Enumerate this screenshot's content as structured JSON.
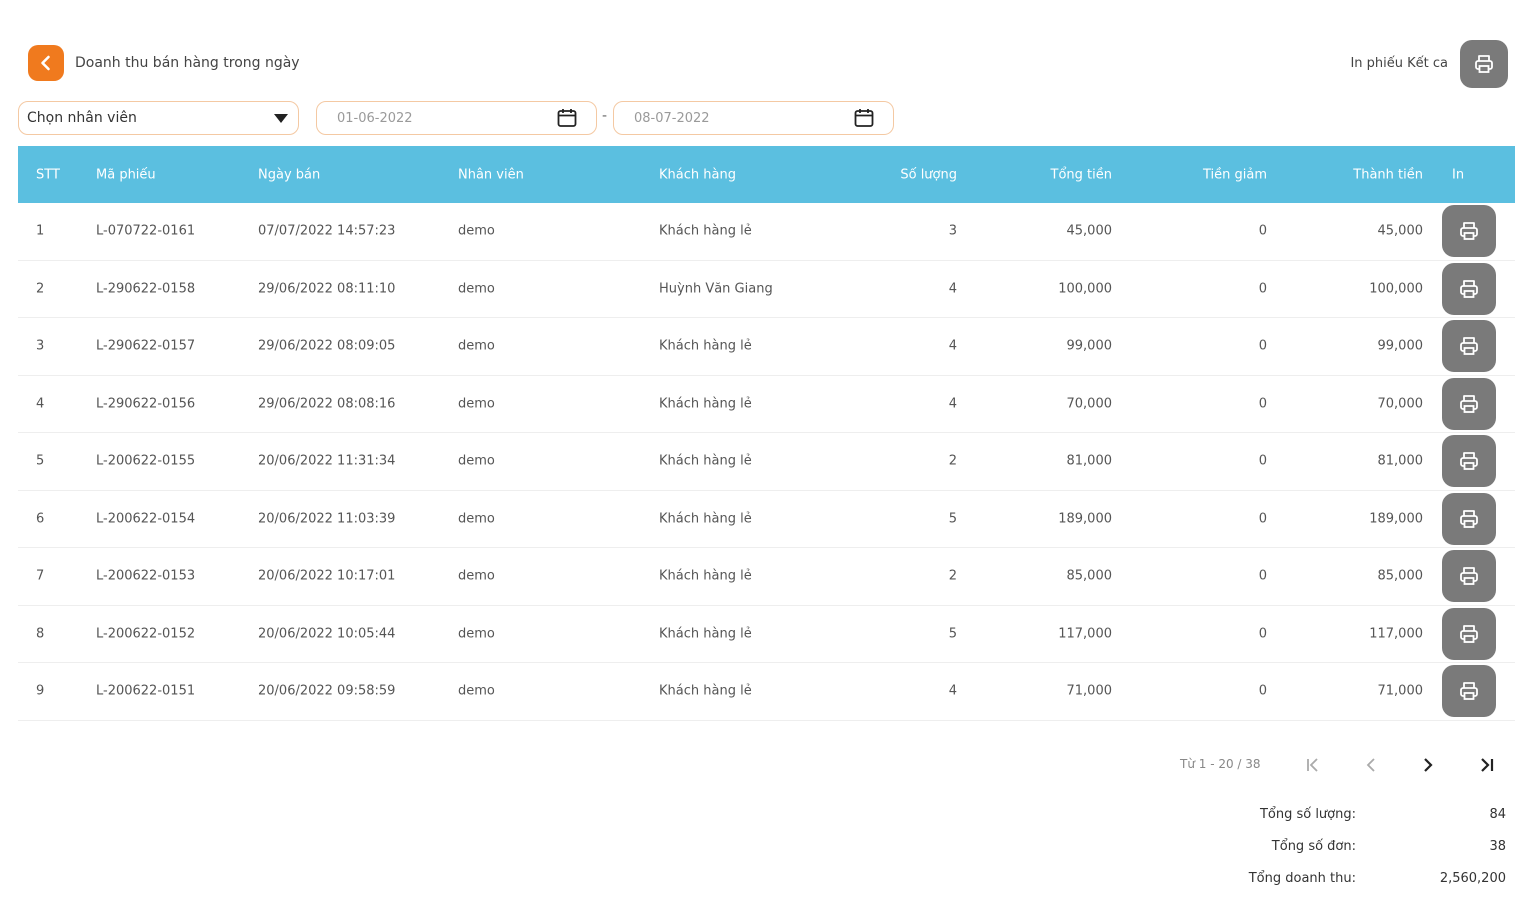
{
  "header": {
    "title": "Doanh thu bán hàng trong ngày",
    "print_summary_label": "In phiếu Kết ca",
    "back_icon": "chevron-left-icon",
    "print_icon": "printer-icon"
  },
  "filters": {
    "employee_select": "Chọn nhân viên",
    "date_from": "01-06-2022",
    "date_to": "08-07-2022",
    "separator": "-"
  },
  "table": {
    "columns": [
      "STT",
      "Mã phiếu",
      "Ngày bán",
      "Nhân viên",
      "Khách hàng",
      "Số lượng",
      "Tổng tiền",
      "Tiền giảm",
      "Thành tiền",
      "In"
    ],
    "rows": [
      {
        "stt": "1",
        "code": "L-070722-0161",
        "date": "07/07/2022 14:57:23",
        "employee": "demo",
        "customer": "Khách hàng lẻ",
        "qty": "3",
        "total": "45,000",
        "discount": "0",
        "final": "45,000"
      },
      {
        "stt": "2",
        "code": "L-290622-0158",
        "date": "29/06/2022 08:11:10",
        "employee": "demo",
        "customer": "Huỳnh Văn Giang",
        "qty": "4",
        "total": "100,000",
        "discount": "0",
        "final": "100,000"
      },
      {
        "stt": "3",
        "code": "L-290622-0157",
        "date": "29/06/2022 08:09:05",
        "employee": "demo",
        "customer": "Khách hàng lẻ",
        "qty": "4",
        "total": "99,000",
        "discount": "0",
        "final": "99,000"
      },
      {
        "stt": "4",
        "code": "L-290622-0156",
        "date": "29/06/2022 08:08:16",
        "employee": "demo",
        "customer": "Khách hàng lẻ",
        "qty": "4",
        "total": "70,000",
        "discount": "0",
        "final": "70,000"
      },
      {
        "stt": "5",
        "code": "L-200622-0155",
        "date": "20/06/2022 11:31:34",
        "employee": "demo",
        "customer": "Khách hàng lẻ",
        "qty": "2",
        "total": "81,000",
        "discount": "0",
        "final": "81,000"
      },
      {
        "stt": "6",
        "code": "L-200622-0154",
        "date": "20/06/2022 11:03:39",
        "employee": "demo",
        "customer": "Khách hàng lẻ",
        "qty": "5",
        "total": "189,000",
        "discount": "0",
        "final": "189,000"
      },
      {
        "stt": "7",
        "code": "L-200622-0153",
        "date": "20/06/2022 10:17:01",
        "employee": "demo",
        "customer": "Khách hàng lẻ",
        "qty": "2",
        "total": "85,000",
        "discount": "0",
        "final": "85,000"
      },
      {
        "stt": "8",
        "code": "L-200622-0152",
        "date": "20/06/2022 10:05:44",
        "employee": "demo",
        "customer": "Khách hàng lẻ",
        "qty": "5",
        "total": "117,000",
        "discount": "0",
        "final": "117,000"
      },
      {
        "stt": "9",
        "code": "L-200622-0151",
        "date": "20/06/2022 09:58:59",
        "employee": "demo",
        "customer": "Khách hàng lẻ",
        "qty": "4",
        "total": "71,000",
        "discount": "0",
        "final": "71,000"
      }
    ]
  },
  "pagination": {
    "info": "Từ 1 - 20 / 38"
  },
  "summary": {
    "qty_label": "Tổng số lượng:",
    "qty_value": "84",
    "orders_label": "Tổng số đơn:",
    "orders_value": "38",
    "revenue_label": "Tổng doanh thu:",
    "revenue_value": "2,560,200"
  },
  "colors": {
    "accent_orange": "#f07a1e",
    "header_blue": "#5bbfe0",
    "print_button_gray": "#7a7a7a",
    "input_border": "#f4c9a3"
  }
}
